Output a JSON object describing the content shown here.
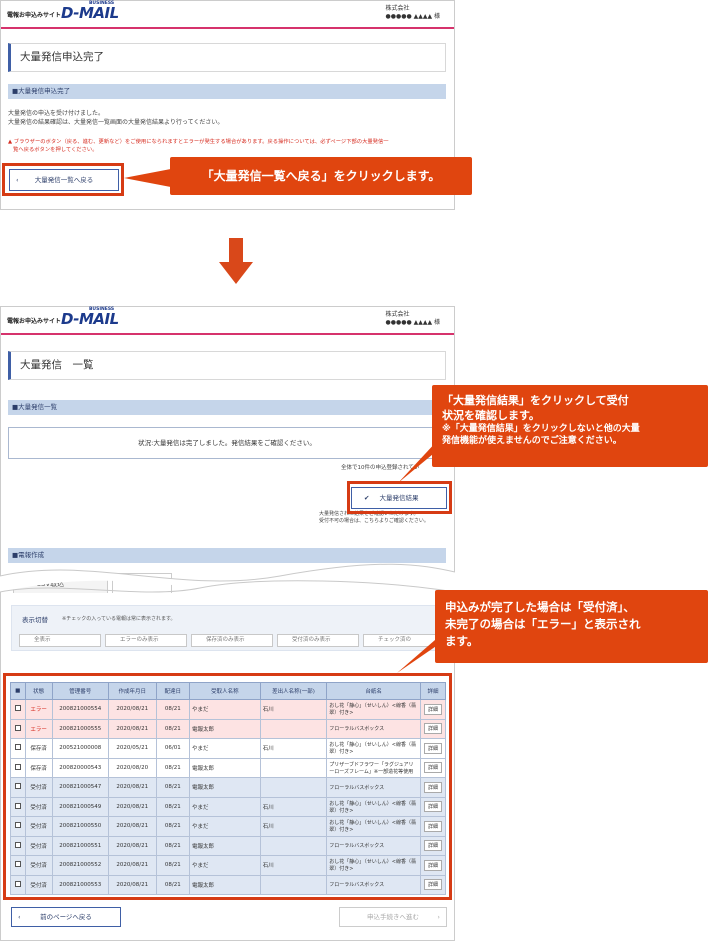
{
  "header": {
    "site_label": "電報お申込みサイト",
    "logo": "D-MAIL",
    "logo_sub": "BUSINESS",
    "company": "株式会社",
    "user": "●●●●● ▲▲▲▲ 様"
  },
  "top": {
    "title": "大量発信申込完了",
    "section": "■大量発信申込完了",
    "msg1": "大量発信の申込を受け付けました。",
    "msg2": "大量発信の結果確認は、大量発信一覧画面の大量発信結果より行ってください。",
    "warn1": "ブラウザーのボタン（戻る、進む、更新など）をご使用になられますとエラーが発生する場合があります。戻る操作については、必ずページ下部の大量発信一",
    "warn2": "覧へ戻るボタンを押してください。",
    "back_button": "大量発信一覧へ戻る",
    "callout": "「大量発信一覧へ戻る」をクリックします。"
  },
  "bottom": {
    "title": "大量発信　一覧",
    "section": "■大量発信一覧",
    "status": "状況:大量発信は完了しました。発信結果をご確認ください。",
    "count_note": "全体で10件の申込登録されてい",
    "result_button": "大量発信結果",
    "note1": "大量発信された結果をご確認いただけます。",
    "note2": "受付不可の場合は、こちらよりご確認ください。",
    "section2": "■電報作成",
    "csv_tab": "CSV取込",
    "switch_label": "表示切替",
    "switch_note": "※チェックの入っている電報は常に表示されます。",
    "filters": [
      "全表示",
      "エラーのみ表示",
      "保存済のみ表示",
      "受付済のみ表示",
      "チェック済の"
    ],
    "callout1_l1": "「大量発信結果」をクリックして受付",
    "callout1_l2": "状況を確認します。",
    "callout1_l3": "※「大量発信結果」をクリックしないと他の大量",
    "callout1_l4": "発信機能が使えませんのでご注意ください。",
    "callout2_l1": "申込みが完了した場合は「受付済」、",
    "callout2_l2": "未完了の場合は「エラー」と表示され",
    "callout2_l3": "ます。",
    "columns": [
      "■",
      "状態",
      "管理番号",
      "作成年月日",
      "配達日",
      "受取人名称",
      "差出人名称(一部)",
      "台紙名",
      "詳細"
    ],
    "rows": [
      {
        "st": "エラー",
        "no": "200821000554",
        "made": "2020/08/21",
        "del": "08/21",
        "to": "やまだ",
        "from": "石川",
        "mount": "おし花「静心」（せいしん）<線香（翡翠）付き>",
        "type": "err"
      },
      {
        "st": "エラー",
        "no": "200821000555",
        "made": "2020/08/21",
        "del": "08/21",
        "to": "電報太郎",
        "from": "",
        "mount": "フローラルバスボックス",
        "type": "err"
      },
      {
        "st": "保存済",
        "no": "200521000008",
        "made": "2020/05/21",
        "del": "06/01",
        "to": "やまだ",
        "from": "石川",
        "mount": "おし花「静心」（せいしん）<線香（翡翠）付き>",
        "type": "wht"
      },
      {
        "st": "保存済",
        "no": "200820000543",
        "made": "2020/08/20",
        "del": "08/21",
        "to": "電報太郎",
        "from": "",
        "mount": "プリザーブドフラワー「ラグジュアリーローズフレーム」※一部造花等使用",
        "type": "wht"
      },
      {
        "st": "受付済",
        "no": "200821000547",
        "made": "2020/08/21",
        "del": "08/21",
        "to": "電報太郎",
        "from": "",
        "mount": "フローラルバスボックス",
        "type": "ok"
      },
      {
        "st": "受付済",
        "no": "200821000549",
        "made": "2020/08/21",
        "del": "08/21",
        "to": "やまだ",
        "from": "石川",
        "mount": "おし花「静心」（せいしん）<線香（翡翠）付き>",
        "type": "ok"
      },
      {
        "st": "受付済",
        "no": "200821000550",
        "made": "2020/08/21",
        "del": "08/21",
        "to": "やまだ",
        "from": "石川",
        "mount": "おし花「静心」（せいしん）<線香（翡翠）付き>",
        "type": "ok"
      },
      {
        "st": "受付済",
        "no": "200821000551",
        "made": "2020/08/21",
        "del": "08/21",
        "to": "電報太郎",
        "from": "",
        "mount": "フローラルバスボックス",
        "type": "ok"
      },
      {
        "st": "受付済",
        "no": "200821000552",
        "made": "2020/08/21",
        "del": "08/21",
        "to": "やまだ",
        "from": "石川",
        "mount": "おし花「静心」（せいしん）<線香（翡翠）付き>",
        "type": "ok"
      },
      {
        "st": "受付済",
        "no": "200821000553",
        "made": "2020/08/21",
        "del": "08/21",
        "to": "電報太郎",
        "from": "",
        "mount": "フローラルバスボックス",
        "type": "ok"
      }
    ],
    "detail_label": "詳細",
    "prev_button": "前のページへ戻る",
    "next_button": "申込手続きへ進む"
  }
}
